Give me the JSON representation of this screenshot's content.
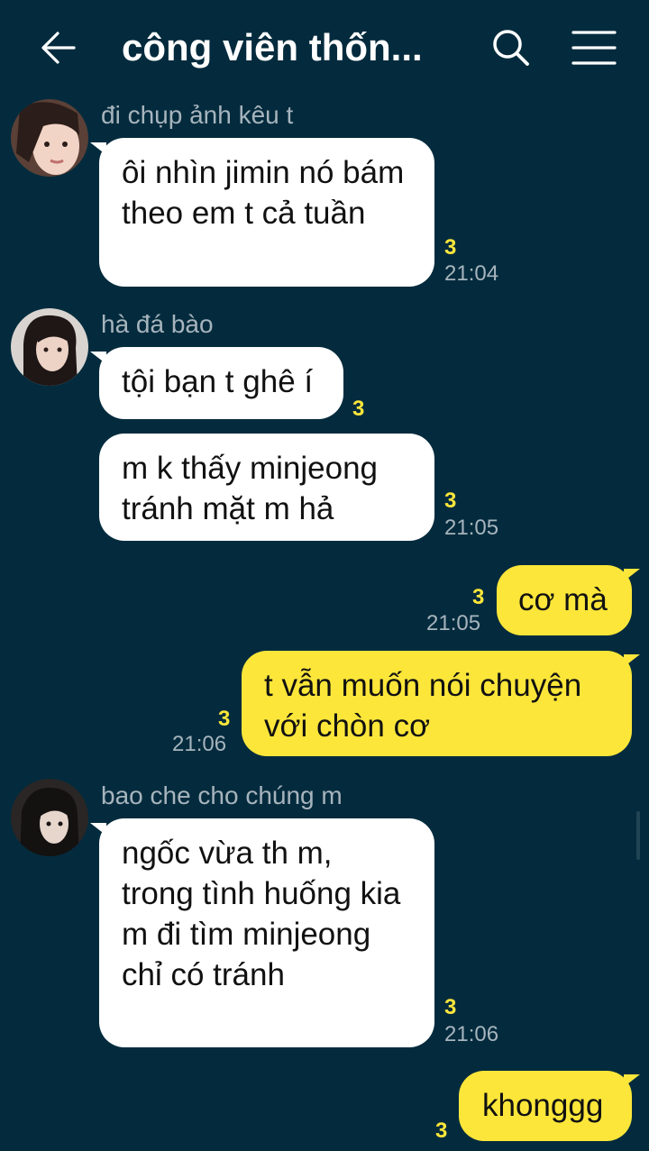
{
  "header": {
    "title": "công viên thốn...",
    "icons": {
      "back": "arrow-left-icon",
      "search": "search-icon",
      "menu": "hamburger-menu-icon"
    }
  },
  "colors": {
    "background": "#032b3d",
    "incoming_bubble": "#ffffff",
    "outgoing_bubble": "#fce63a",
    "unread": "#fce63a",
    "meta_text": "#a7b4bd"
  },
  "messages": [
    {
      "direction": "in",
      "sender": "đi chụp ảnh kêu t",
      "text": "ôi nhìn jimin nó bám theo em t cả tuần",
      "unread": "3",
      "time": "21:04"
    },
    {
      "direction": "in",
      "sender": "hà đá bào",
      "text": "tội bạn t ghê í",
      "unread": "3",
      "time": ""
    },
    {
      "direction": "in",
      "sender": "",
      "text": "m k thấy minjeong tránh mặt m hả",
      "unread": "3",
      "time": "21:05"
    },
    {
      "direction": "out",
      "text": "cơ mà",
      "unread": "3",
      "time": "21:05"
    },
    {
      "direction": "out",
      "text": "t vẫn muốn nói chuyện với chòn cơ",
      "unread": "3",
      "time": "21:06"
    },
    {
      "direction": "in",
      "sender": "bao che cho chúng m",
      "text": "ngốc vừa th m, trong tình huống kia m đi tìm minjeong chỉ có tránh",
      "unread": "3",
      "time": "21:06"
    },
    {
      "direction": "out",
      "text": "khonggg",
      "unread": "3",
      "time": ""
    }
  ]
}
